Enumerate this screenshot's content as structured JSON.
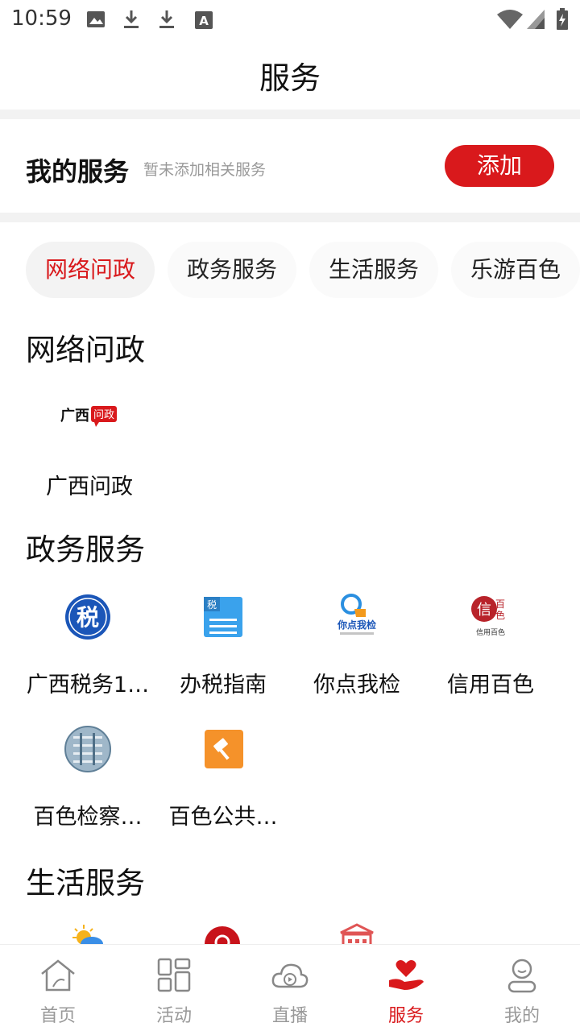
{
  "status_bar": {
    "time": "10:59"
  },
  "header": {
    "title": "服务"
  },
  "my_services": {
    "title": "我的服务",
    "description": "暂未添加相关服务",
    "add_label": "添加"
  },
  "tabs": [
    {
      "label": "网络问政",
      "active": true
    },
    {
      "label": "政务服务",
      "active": false
    },
    {
      "label": "生活服务",
      "active": false
    },
    {
      "label": "乐游百色",
      "active": false
    }
  ],
  "sections": {
    "network": {
      "title": "网络问政",
      "items": [
        {
          "label": "广西问政",
          "icon": "guangxi-wenzheng-logo",
          "logo_text": "广西",
          "logo_badge": "问政"
        }
      ]
    },
    "government": {
      "title": "政务服务",
      "items": [
        {
          "label": "广西税务1…",
          "icon": "tax-badge-icon",
          "logo_text": "税"
        },
        {
          "label": "办税指南",
          "icon": "tax-guide-icon",
          "logo_text": "税"
        },
        {
          "label": "你点我检",
          "icon": "you-point-i-check-icon",
          "logo_text": "你点我检"
        },
        {
          "label": "信用百色",
          "icon": "credit-baise-icon",
          "logo_text": "信用百色"
        },
        {
          "label": "百色检察…",
          "icon": "procuratorate-icon"
        },
        {
          "label": "百色公共…",
          "icon": "public-resource-icon"
        }
      ]
    },
    "life": {
      "title": "生活服务"
    }
  },
  "bottom_nav": [
    {
      "label": "首页",
      "icon": "home-icon",
      "active": false
    },
    {
      "label": "活动",
      "icon": "grid-icon",
      "active": false
    },
    {
      "label": "直播",
      "icon": "live-cloud-icon",
      "active": false
    },
    {
      "label": "服务",
      "icon": "heart-hand-icon",
      "active": true
    },
    {
      "label": "我的",
      "icon": "profile-icon",
      "active": false
    }
  ],
  "colors": {
    "accent": "#d9191c",
    "muted": "#999999",
    "band": "#f2f2f2"
  }
}
